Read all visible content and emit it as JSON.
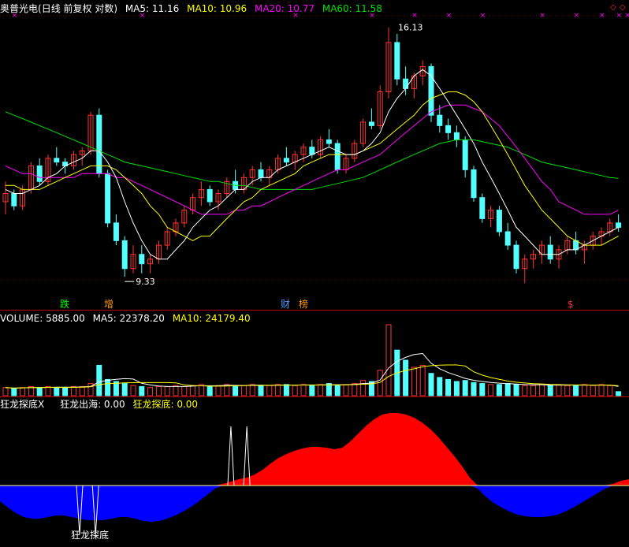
{
  "header": {
    "stock_name": "奥普光电",
    "period": "(日线 前复权 对数)",
    "ma5": "MA5: 11.16",
    "ma10": "MA10: 10.96",
    "ma20": "MA20: 10.77",
    "ma60": "MA60: 11.58"
  },
  "price_panel": {
    "high_label": "16.13",
    "low_label": "9.33",
    "events": [
      "跌",
      "增",
      "财",
      "榜",
      "$"
    ],
    "colors": {
      "up": "#ff3333",
      "down": "#54ffff",
      "ma5": "#ffffff",
      "ma10": "#ffff00",
      "ma20": "#ff00ff",
      "ma60": "#00e000"
    },
    "ohlc": [
      [
        11.0,
        11.5,
        10.7,
        11.2
      ],
      [
        11.2,
        11.3,
        10.8,
        10.9
      ],
      [
        10.9,
        11.4,
        10.8,
        11.3
      ],
      [
        11.3,
        12.0,
        11.2,
        11.9
      ],
      [
        11.9,
        12.1,
        11.4,
        11.5
      ],
      [
        11.5,
        12.2,
        11.4,
        12.1
      ],
      [
        12.1,
        12.4,
        11.9,
        12.0
      ],
      [
        12.0,
        12.1,
        11.7,
        11.9
      ],
      [
        11.9,
        12.3,
        11.8,
        12.2
      ],
      [
        12.2,
        12.4,
        11.9,
        12.3
      ],
      [
        12.3,
        13.4,
        12.2,
        13.3
      ],
      [
        13.3,
        13.5,
        11.6,
        11.7
      ],
      [
        11.7,
        11.8,
        10.4,
        10.5
      ],
      [
        10.5,
        10.7,
        10.0,
        10.1
      ],
      [
        10.1,
        10.2,
        9.33,
        9.5
      ],
      [
        9.5,
        10.0,
        9.4,
        9.8
      ],
      [
        9.8,
        10.0,
        9.4,
        9.6
      ],
      [
        9.6,
        9.8,
        9.4,
        9.7
      ],
      [
        9.7,
        10.1,
        9.6,
        10.0
      ],
      [
        10.0,
        10.4,
        9.9,
        10.3
      ],
      [
        10.3,
        10.6,
        10.2,
        10.5
      ],
      [
        10.5,
        10.9,
        10.4,
        10.8
      ],
      [
        10.8,
        11.2,
        10.7,
        11.1
      ],
      [
        11.1,
        11.5,
        10.9,
        11.3
      ],
      [
        11.3,
        11.4,
        10.9,
        11.0
      ],
      [
        11.0,
        11.3,
        10.8,
        11.2
      ],
      [
        11.2,
        11.6,
        11.1,
        11.5
      ],
      [
        11.5,
        11.8,
        11.2,
        11.3
      ],
      [
        11.3,
        11.7,
        11.2,
        11.6
      ],
      [
        11.6,
        11.9,
        11.4,
        11.8
      ],
      [
        11.8,
        12.0,
        11.5,
        11.6
      ],
      [
        11.6,
        11.9,
        11.4,
        11.8
      ],
      [
        11.8,
        12.2,
        11.7,
        12.1
      ],
      [
        12.1,
        12.4,
        11.9,
        12.0
      ],
      [
        12.0,
        12.3,
        11.8,
        12.2
      ],
      [
        12.2,
        12.5,
        12.0,
        12.4
      ],
      [
        12.4,
        12.6,
        12.1,
        12.2
      ],
      [
        12.2,
        12.7,
        12.1,
        12.6
      ],
      [
        12.6,
        12.9,
        12.4,
        12.5
      ],
      [
        12.5,
        12.6,
        11.7,
        11.8
      ],
      [
        11.8,
        12.2,
        11.7,
        12.1
      ],
      [
        12.1,
        12.6,
        12.0,
        12.5
      ],
      [
        12.5,
        13.2,
        12.4,
        13.1
      ],
      [
        13.1,
        13.5,
        12.9,
        13.0
      ],
      [
        13.0,
        14.2,
        12.9,
        14.0
      ],
      [
        14.0,
        16.13,
        13.8,
        15.6
      ],
      [
        15.6,
        15.9,
        14.2,
        14.4
      ],
      [
        14.4,
        14.8,
        13.9,
        14.1
      ],
      [
        14.1,
        14.6,
        13.8,
        14.5
      ],
      [
        14.5,
        15.0,
        14.2,
        14.8
      ],
      [
        14.8,
        14.9,
        13.1,
        13.3
      ],
      [
        13.3,
        13.6,
        12.8,
        13.0
      ],
      [
        13.0,
        13.2,
        12.6,
        12.8
      ],
      [
        12.8,
        13.0,
        12.4,
        12.6
      ],
      [
        12.6,
        12.7,
        11.6,
        11.8
      ],
      [
        11.8,
        11.9,
        11.0,
        11.1
      ],
      [
        11.1,
        11.2,
        10.5,
        10.6
      ],
      [
        10.6,
        10.9,
        10.4,
        10.8
      ],
      [
        10.8,
        10.9,
        10.2,
        10.3
      ],
      [
        10.3,
        10.5,
        9.9,
        10.0
      ],
      [
        10.0,
        10.1,
        9.4,
        9.5
      ],
      [
        9.5,
        9.8,
        9.2,
        9.7
      ],
      [
        9.7,
        9.9,
        9.5,
        9.8
      ],
      [
        9.8,
        10.1,
        9.6,
        10.0
      ],
      [
        10.0,
        10.2,
        9.6,
        9.7
      ],
      [
        9.7,
        10.0,
        9.5,
        9.9
      ],
      [
        9.9,
        10.2,
        9.8,
        10.1
      ],
      [
        10.1,
        10.3,
        9.8,
        9.9
      ],
      [
        9.9,
        10.1,
        9.6,
        10.0
      ],
      [
        10.0,
        10.3,
        9.9,
        10.2
      ],
      [
        10.2,
        10.4,
        10.0,
        10.3
      ],
      [
        10.3,
        10.6,
        10.2,
        10.5
      ],
      [
        10.5,
        10.7,
        10.3,
        10.4
      ]
    ],
    "ma5": [
      11.3,
      11.2,
      11.2,
      11.3,
      11.4,
      11.6,
      11.7,
      11.9,
      12.0,
      12.1,
      12.3,
      12.3,
      12.0,
      11.6,
      11.0,
      10.5,
      10.1,
      9.8,
      9.7,
      9.7,
      9.9,
      10.1,
      10.4,
      10.6,
      10.8,
      10.9,
      11.1,
      11.3,
      11.3,
      11.5,
      11.6,
      11.6,
      11.8,
      11.9,
      12.0,
      12.1,
      12.2,
      12.3,
      12.4,
      12.3,
      12.2,
      12.2,
      12.3,
      12.5,
      12.8,
      13.4,
      13.8,
      14.1,
      14.5,
      14.7,
      14.5,
      14.1,
      13.7,
      13.3,
      12.9,
      12.5,
      12.0,
      11.6,
      11.2,
      10.8,
      10.4,
      10.2,
      10.0,
      9.8,
      9.8,
      9.8,
      9.9,
      9.9,
      10.0,
      10.1,
      10.2,
      10.3,
      10.4
    ],
    "ma10": [
      11.4,
      11.4,
      11.3,
      11.3,
      11.3,
      11.4,
      11.5,
      11.6,
      11.7,
      11.8,
      11.9,
      11.9,
      11.9,
      11.8,
      11.6,
      11.4,
      11.2,
      10.9,
      10.7,
      10.4,
      10.3,
      10.2,
      10.1,
      10.2,
      10.2,
      10.4,
      10.6,
      10.8,
      11.0,
      11.1,
      11.3,
      11.4,
      11.5,
      11.6,
      11.7,
      11.9,
      12.0,
      12.1,
      12.2,
      12.2,
      12.2,
      12.2,
      12.3,
      12.4,
      12.5,
      12.7,
      12.9,
      13.1,
      13.3,
      13.6,
      13.8,
      13.9,
      14.0,
      14.0,
      13.9,
      13.7,
      13.4,
      13.0,
      12.6,
      12.2,
      11.8,
      11.4,
      11.1,
      10.8,
      10.6,
      10.4,
      10.2,
      10.1,
      10.0,
      10.0,
      10.0,
      10.1,
      10.2
    ],
    "ma20": [
      11.9,
      11.8,
      11.7,
      11.7,
      11.6,
      11.6,
      11.6,
      11.6,
      11.6,
      11.7,
      11.7,
      11.7,
      11.7,
      11.6,
      11.6,
      11.5,
      11.4,
      11.3,
      11.2,
      11.1,
      11.0,
      10.9,
      10.8,
      10.7,
      10.7,
      10.7,
      10.7,
      10.8,
      10.8,
      10.9,
      10.9,
      11.0,
      11.1,
      11.2,
      11.3,
      11.4,
      11.5,
      11.6,
      11.7,
      11.8,
      11.8,
      11.9,
      12.0,
      12.1,
      12.2,
      12.4,
      12.6,
      12.8,
      13.0,
      13.2,
      13.4,
      13.5,
      13.6,
      13.6,
      13.6,
      13.5,
      13.4,
      13.2,
      13.0,
      12.7,
      12.4,
      12.1,
      11.8,
      11.5,
      11.3,
      11.0,
      10.9,
      10.8,
      10.7,
      10.7,
      10.7,
      10.7,
      10.8
    ],
    "ma60": [
      13.4,
      13.3,
      13.2,
      13.1,
      13.0,
      12.9,
      12.8,
      12.7,
      12.6,
      12.5,
      12.4,
      12.3,
      12.2,
      12.1,
      12.0,
      11.95,
      11.9,
      11.85,
      11.8,
      11.75,
      11.7,
      11.65,
      11.6,
      11.55,
      11.5,
      11.5,
      11.45,
      11.4,
      11.4,
      11.35,
      11.3,
      11.3,
      11.3,
      11.3,
      11.3,
      11.3,
      11.3,
      11.35,
      11.4,
      11.45,
      11.5,
      11.55,
      11.6,
      11.7,
      11.8,
      11.9,
      12.0,
      12.1,
      12.2,
      12.3,
      12.4,
      12.5,
      12.55,
      12.6,
      12.6,
      12.6,
      12.55,
      12.5,
      12.45,
      12.4,
      12.3,
      12.2,
      12.1,
      12.0,
      11.95,
      11.9,
      11.85,
      11.8,
      11.75,
      11.7,
      11.65,
      11.6,
      11.58
    ]
  },
  "volume_panel": {
    "volume": "VOLUME: 5885.00",
    "ma5": "MA5: 22378.20",
    "ma10": "MA10: 24179.40",
    "values": [
      8,
      7,
      8,
      9,
      8,
      9,
      8,
      8,
      9,
      9,
      12,
      30,
      16,
      14,
      12,
      10,
      9,
      8,
      9,
      9,
      10,
      9,
      10,
      11,
      9,
      10,
      11,
      10,
      10,
      11,
      10,
      10,
      11,
      11,
      10,
      11,
      10,
      11,
      12,
      10,
      11,
      12,
      15,
      14,
      25,
      70,
      45,
      35,
      28,
      30,
      22,
      18,
      16,
      14,
      15,
      13,
      12,
      11,
      11,
      12,
      11,
      10,
      10,
      11,
      10,
      11,
      10,
      10,
      11,
      10,
      11,
      10,
      4
    ]
  },
  "indicator_panel": {
    "title": "狂龙探底X",
    "line1": "狂龙出海: 0.00",
    "line2": "狂龙探底: 0.00",
    "marker": "狂龙探底",
    "values": [
      -20,
      -28,
      -35,
      -40,
      -42,
      -42,
      -40,
      -38,
      -38,
      -40,
      -42,
      -44,
      -44,
      -44,
      -42,
      -40,
      -40,
      -42,
      -45,
      -46,
      -45,
      -42,
      -38,
      -33,
      -27,
      -20,
      -12,
      -4,
      2,
      5,
      8,
      10,
      14,
      20,
      28,
      35,
      40,
      44,
      47,
      49,
      49,
      48,
      46,
      48,
      56,
      66,
      76,
      84,
      90,
      92,
      92,
      90,
      86,
      80,
      72,
      62,
      50,
      38,
      25,
      10,
      -4,
      -14,
      -22,
      -28,
      -33,
      -37,
      -39,
      -40,
      -40,
      -39,
      -37,
      -33,
      -28,
      -22,
      -16,
      -10,
      -4,
      2,
      6,
      8
    ],
    "spikes_up": [
      29,
      31
    ],
    "spikes_down": [
      10,
      12
    ]
  }
}
